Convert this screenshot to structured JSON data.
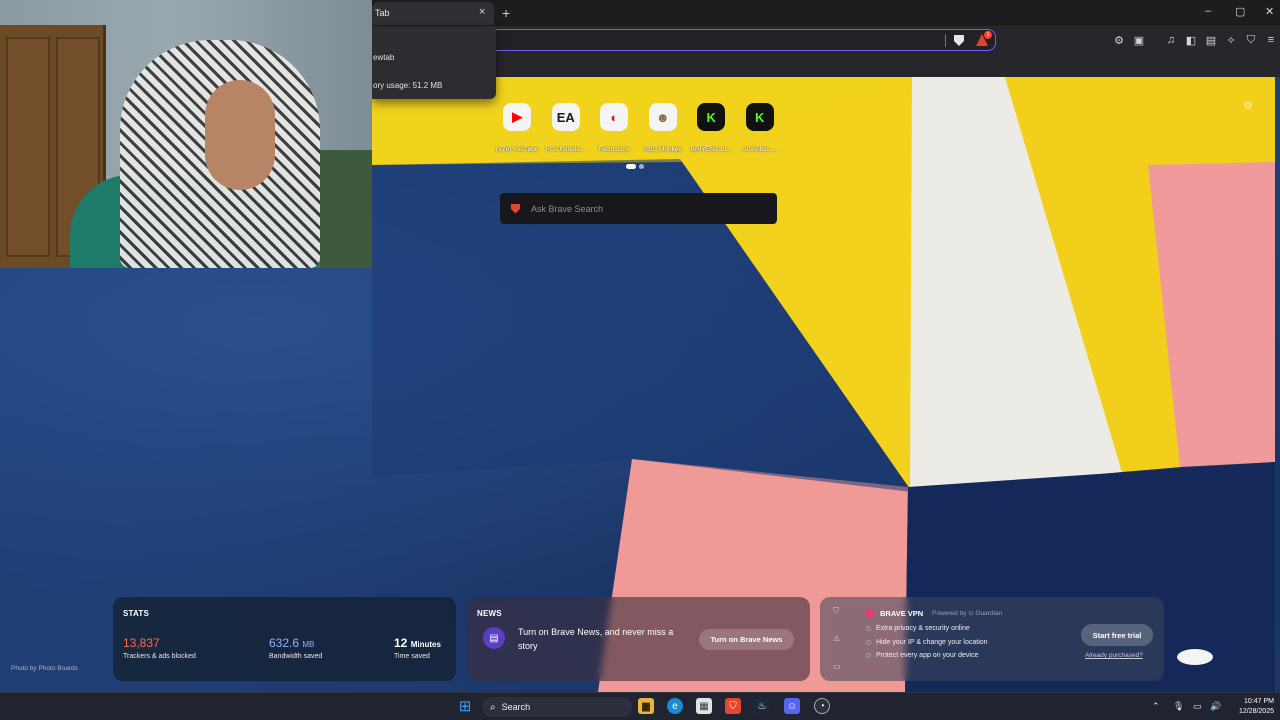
{
  "browser": {
    "tab_title": "Tab",
    "tab_close": "×",
    "new_tab": "+",
    "window_minimize": "–",
    "window_maximize": "▢",
    "window_close": "✕",
    "memory_popup": {
      "url_fragment": "ewtab",
      "usage_text": "ory usage: 51.2 MB"
    },
    "notification_count": "1"
  },
  "newtab": {
    "top_sites": [
      {
        "icon": "youtube-icon",
        "glyph": "▶",
        "color": "#ff0000",
        "label": "(176) YouTube"
      },
      {
        "icon": "ea-icon",
        "glyph": "EA",
        "color": "#1a1a1a",
        "label": "FC Ultimate..."
      },
      {
        "icon": "flashscore-icon",
        "glyph": "◐",
        "color": "#c8102e",
        "label": "Flashscore"
      },
      {
        "icon": "sbc-monkey-icon",
        "glyph": "☻",
        "color": "#8b6b3d",
        "label": "SBC Monkey"
      },
      {
        "icon": "kick-icon",
        "glyph": "K",
        "color": "#53fc18",
        "label": "BRIYEN1 St..."
      },
      {
        "icon": "kick-icon",
        "glyph": "K",
        "color": "#53fc18",
        "label": "ArfaVibes ..."
      }
    ],
    "search_placeholder": "Ask Brave Search",
    "photo_credit": "Photo by Photo Boards"
  },
  "widgets": {
    "stats": {
      "title": "STATS",
      "trackers_value": "13,837",
      "trackers_label": "Trackers & ads blocked",
      "trackers_color": "#ff6a4a",
      "bandwidth_value": "632.6",
      "bandwidth_unit": "MB",
      "bandwidth_label": "Bandwidth saved",
      "bandwidth_color": "#8fb0ff",
      "time_value": "12",
      "time_unit": "Minutes",
      "time_label": "Time saved"
    },
    "news": {
      "title": "NEWS",
      "text": "Turn on Brave News, and never miss a story",
      "button": "Turn on Brave News"
    },
    "vpn": {
      "title": "BRAVE VPN",
      "powered_by": "Powered by ⊙ Guardian",
      "features": [
        "Extra privacy & security online",
        "Hide your IP & change your location",
        "Protect every app on your device"
      ],
      "cta": "Start free trial",
      "link": "Already purchased?"
    }
  },
  "taskbar": {
    "search_label": "Search",
    "time": "10:47 PM",
    "date": "12/28/2025"
  }
}
